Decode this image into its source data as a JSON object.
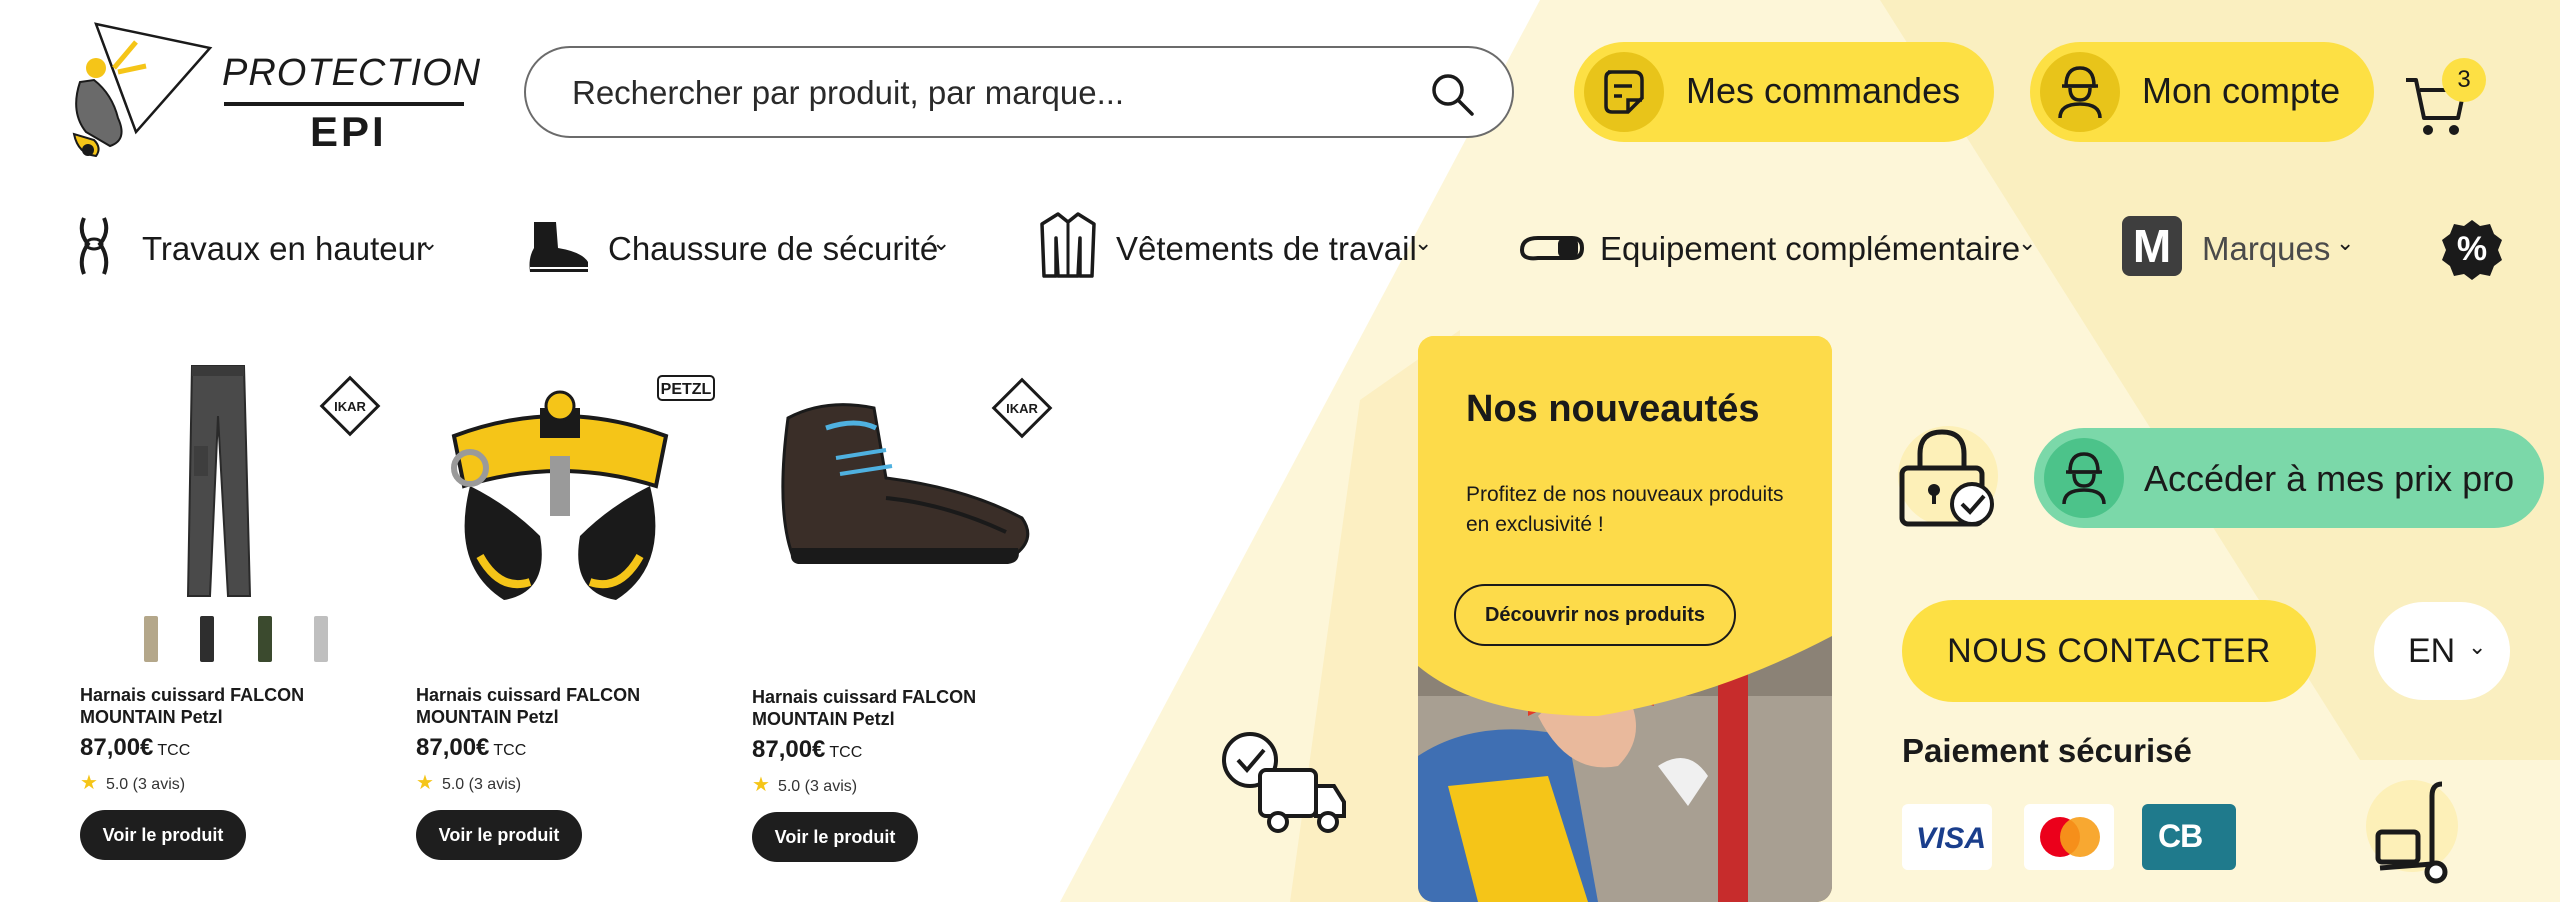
{
  "brand": {
    "line1": "PROTECTION",
    "line2": "EPI"
  },
  "search": {
    "placeholder": "Rechercher par produit, par marque..."
  },
  "header": {
    "orders_label": "Mes commandes",
    "account_label": "Mon compte",
    "cart_count": "3"
  },
  "nav": {
    "items": [
      {
        "label": "Travaux en hauteur",
        "icon": "harness-icon"
      },
      {
        "label": "Chaussure de sécurité",
        "icon": "boot-icon"
      },
      {
        "label": "Vêtements de travail",
        "icon": "jacket-icon"
      },
      {
        "label": "Equipement complémentaire",
        "icon": "headlamp-icon"
      },
      {
        "label": "Marques",
        "icon": "brand-m-icon"
      }
    ],
    "promo_icon": "percent-badge-icon",
    "promo_glyph": "%",
    "brand_glyph": "M"
  },
  "products": [
    {
      "name": "Harnais cuissard FALCON MOUNTAIN Petzl",
      "price": "87,00€",
      "tax": "TCC",
      "rating": "5.0 (3 avis)",
      "button": "Voir le produit",
      "brand_logo": "IKAR"
    },
    {
      "name": "Harnais cuissard FALCON MOUNTAIN Petzl",
      "price": "87,00€",
      "tax": "TCC",
      "rating": "5.0 (3 avis)",
      "button": "Voir le produit",
      "brand_logo": "PETZL"
    },
    {
      "name": "Harnais cuissard FALCON MOUNTAIN Petzl",
      "price": "87,00€",
      "tax": "TCC",
      "rating": "5.0 (3 avis)",
      "button": "Voir le produit",
      "brand_logo": "IKAR"
    }
  ],
  "new_products": {
    "title": "Nos nouveautés",
    "description": "Profitez de nos nouveaux produits en exclusivité !",
    "button": "Découvrir nos produits"
  },
  "pro": {
    "label": "Accéder à mes prix pro"
  },
  "contact": {
    "label": "NOUS CONTACTER"
  },
  "language": {
    "current": "EN"
  },
  "payment": {
    "title": "Paiement sécurisé",
    "visa": "VISA",
    "cb": "CB"
  },
  "colors": {
    "yellow": "#fde044",
    "green": "#7bd8a9",
    "cream": "#fdf6d3"
  }
}
